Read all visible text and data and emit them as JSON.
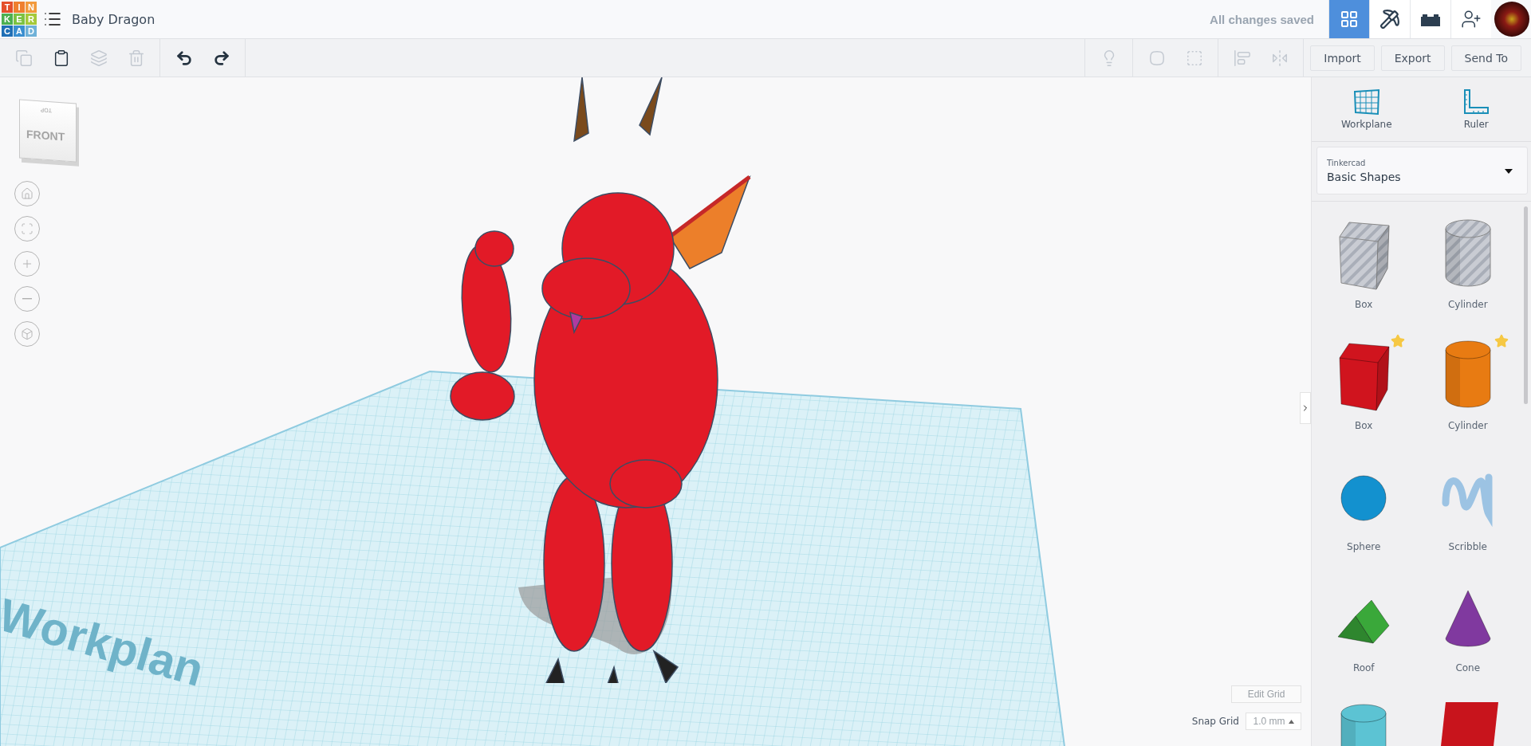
{
  "app": {
    "logo": [
      {
        "letter": "T",
        "color": "#e4502b"
      },
      {
        "letter": "I",
        "color": "#ef7f2e"
      },
      {
        "letter": "N",
        "color": "#f29a3c"
      },
      {
        "letter": "K",
        "color": "#4caf50"
      },
      {
        "letter": "E",
        "color": "#7cc242"
      },
      {
        "letter": "R",
        "color": "#a5c93a"
      },
      {
        "letter": "C",
        "color": "#1f6fb5"
      },
      {
        "letter": "A",
        "color": "#3a8fd0"
      },
      {
        "letter": "D",
        "color": "#6fb1d8"
      }
    ],
    "title": "Baby Dragon",
    "save_status": "All changes saved"
  },
  "views": [
    {
      "kind": "grid",
      "selected": true
    },
    {
      "kind": "pickaxe",
      "selected": false
    },
    {
      "kind": "bricks",
      "selected": false
    },
    {
      "kind": "add-user",
      "selected": false
    }
  ],
  "edit_tools": [
    {
      "kind": "copy",
      "disabled": true
    },
    {
      "kind": "paste",
      "disabled": false
    },
    {
      "kind": "duplicate",
      "disabled": true
    },
    {
      "kind": "delete",
      "disabled": true
    }
  ],
  "history_tools": [
    {
      "kind": "undo",
      "disabled": false
    },
    {
      "kind": "redo",
      "disabled": false
    }
  ],
  "shape_tool_groups": [
    {
      "tools": [
        {
          "kind": "note",
          "disabled": true
        }
      ]
    },
    {
      "tools": [
        {
          "kind": "group",
          "disabled": true
        },
        {
          "kind": "ungroup",
          "disabled": true
        }
      ]
    },
    {
      "tools": [
        {
          "kind": "align",
          "disabled": true
        },
        {
          "kind": "mirror",
          "disabled": true
        }
      ]
    }
  ],
  "actions": [
    "Import",
    "Export",
    "Send To"
  ],
  "canvas": {
    "view_cube": {
      "front": "FRONT",
      "top": "TOP"
    },
    "nav_buttons": [
      {
        "kind": "home"
      },
      {
        "kind": "fit"
      },
      {
        "kind": "zoom-in"
      },
      {
        "kind": "zoom-out"
      },
      {
        "kind": "perspective"
      }
    ],
    "workplane_label": "Workplan",
    "edit_grid": "Edit Grid",
    "snap_grid": {
      "label": "Snap Grid",
      "value": "1.0 mm"
    }
  },
  "panel": {
    "tools": [
      {
        "kind": "workplane",
        "label": "Workplane"
      },
      {
        "kind": "ruler",
        "label": "Ruler"
      }
    ],
    "library": {
      "source": "Tinkercad",
      "value": "Basic Shapes"
    },
    "shapes": [
      {
        "kind": "box",
        "label": "Box",
        "hole": true,
        "favorite": false,
        "color": "#c9ccd3"
      },
      {
        "kind": "cylinder",
        "label": "Cylinder",
        "hole": true,
        "favorite": false,
        "color": "#c9ccd3"
      },
      {
        "kind": "box",
        "label": "Box",
        "hole": false,
        "favorite": true,
        "color": "#d0141e"
      },
      {
        "kind": "cylinder",
        "label": "Cylinder",
        "hole": false,
        "favorite": true,
        "color": "#e87b12"
      },
      {
        "kind": "sphere",
        "label": "Sphere",
        "hole": false,
        "favorite": false,
        "color": "#1391cf"
      },
      {
        "kind": "scribble",
        "label": "Scribble",
        "hole": false,
        "favorite": false,
        "color": "#9cc3e3"
      },
      {
        "kind": "roof",
        "label": "Roof",
        "hole": false,
        "favorite": false,
        "color": "#3aa83a"
      },
      {
        "kind": "cone",
        "label": "Cone",
        "hole": false,
        "favorite": false,
        "color": "#80399f"
      },
      {
        "kind": "cylinder",
        "hole": false,
        "color": "#5cc3d3"
      },
      {
        "kind": "text",
        "hole": false,
        "color": "#c8141c"
      }
    ]
  }
}
